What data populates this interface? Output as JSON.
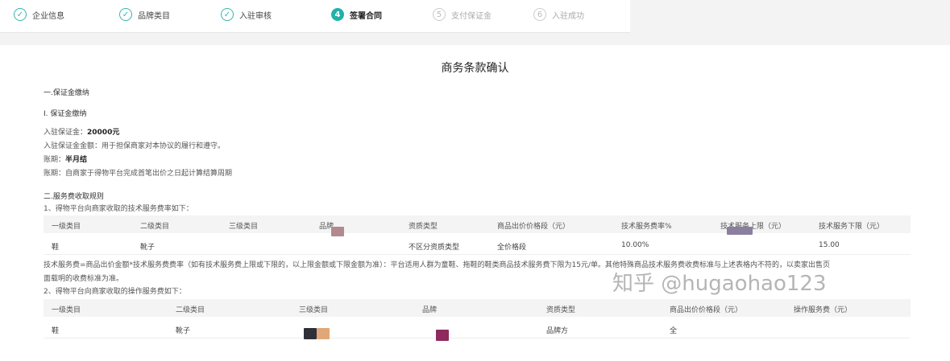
{
  "stepper": {
    "steps": [
      {
        "num": "✓",
        "label": "企业信息",
        "state": "done"
      },
      {
        "num": "✓",
        "label": "品牌类目",
        "state": "done"
      },
      {
        "num": "✓",
        "label": "入驻审核",
        "state": "done"
      },
      {
        "num": "4",
        "label": "签署合同",
        "state": "active"
      },
      {
        "num": "5",
        "label": "支付保证金",
        "state": "todo"
      },
      {
        "num": "6",
        "label": "入驻成功",
        "state": "todo"
      }
    ]
  },
  "doc": {
    "title": "商务条款确认",
    "section1": "一.保证金缴纳",
    "sub1": "I. 保证金缴纳",
    "deposit_label": "入驻保证金：",
    "deposit_value": "20000元",
    "deposit_desc": "入驻保证金金额：用于担保商家对本协议的履行和遵守。",
    "period_label": "账期：",
    "period_value": "半月结",
    "period_desc": "账期：自商家于得物平台完成首笔出价之日起计算结算周期",
    "section2": "二.服务费收取规则",
    "item1": "1、得物平台向商家收取的技术服务费率如下：",
    "table1": {
      "headers": [
        "一级类目",
        "二级类目",
        "三级类目",
        "品牌",
        "资质类型",
        "商品出价价格段（元）",
        "技术服务费率%",
        "技术服务上限（元）",
        "技术服务下限（元）"
      ],
      "row": [
        "鞋",
        "靴子",
        "",
        "",
        "不区分资质类型",
        "全价格段",
        "10.00%",
        "",
        "15.00"
      ]
    },
    "note1": "技术服务费=商品出价金额*技术服务费费率（如有技术服务费上限或下限的，以上限金额或下限金额为准）：平台适用人群为童鞋、拖鞋的鞋类商品技术服务费下限为15元/单。其他特殊商品技术服务费收费标准与上述表格内不符的，以卖家出售页",
    "note2": "面载明的收费标准为准。",
    "item2": "2、得物平台向商家收取的操作服务费如下：",
    "table2": {
      "headers": [
        "一级类目",
        "二级类目",
        "三级类目",
        "品牌",
        "资质类型",
        "商品出价价格段（元）",
        "操作服务费（元）"
      ],
      "row": [
        "鞋",
        "靴子",
        "",
        "",
        "品牌方",
        "全",
        ""
      ]
    }
  },
  "watermark": "知乎 @hugaohao123",
  "colors": {
    "accent": "#20b2aa",
    "redact1": "#b08a8f",
    "redact2": "#8a7f9e",
    "redact3": "#2f2f3a",
    "redact4": "#e0a878",
    "redact5": "#8e2a5d"
  }
}
